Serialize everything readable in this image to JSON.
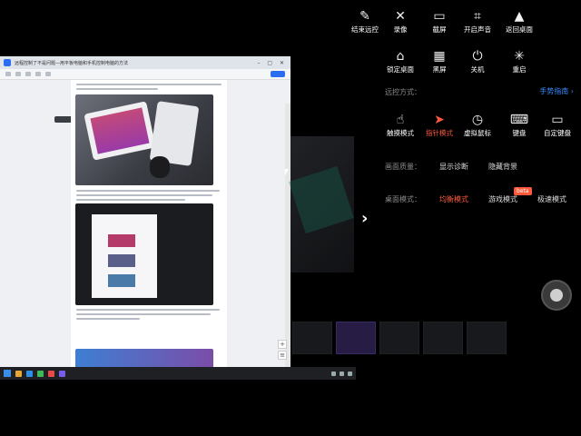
{
  "remote": {
    "doc_title": "远程控制了不是问题—用平板电脑和手机控制电脑的方法",
    "bookmark": "目录目录"
  },
  "toolbar": {
    "row1": [
      {
        "id": "end",
        "icon": "✎",
        "label": "结束远控"
      },
      {
        "id": "close",
        "icon": "✕",
        "label": "录像"
      },
      {
        "id": "record",
        "icon": "▭",
        "label": "截屏"
      },
      {
        "id": "crop",
        "icon": "⌗",
        "label": "开启声音"
      },
      {
        "id": "desktop",
        "icon": "▲",
        "label": "返回桌面"
      }
    ],
    "row2": [
      {
        "id": "lock",
        "icon": "⌂",
        "label": "锁定桌面"
      },
      {
        "id": "blackscreen",
        "icon": "▦",
        "label": "黑屏"
      },
      {
        "id": "power",
        "icon": "⏻",
        "label": "关机"
      },
      {
        "id": "restart",
        "icon": "✳",
        "label": "重启"
      }
    ]
  },
  "control_mode": {
    "label": "远控方式：",
    "guide": "手势指南 ›",
    "options": [
      {
        "icon": "☝",
        "label": "触摸模式",
        "active": false
      },
      {
        "icon": "➤",
        "label": "指针模式",
        "active": true
      },
      {
        "icon": "◷",
        "label": "虚拟鼠标",
        "active": false
      },
      {
        "icon": "⌨",
        "label": "键盘",
        "active": false
      },
      {
        "icon": "▭",
        "label": "自定键盘",
        "active": false
      }
    ]
  },
  "quality": {
    "label": "画面质量：",
    "options": [
      "显示诊断",
      "隐藏背景"
    ]
  },
  "desktop_mode": {
    "label": "桌面模式：",
    "options": [
      {
        "label": "均衡模式",
        "active": true
      },
      {
        "label": "游戏模式",
        "active": false
      },
      {
        "label": "极速模式",
        "active": false
      }
    ],
    "beta": "beta"
  },
  "accent": "#ff5a3c",
  "link": "#3a8bff"
}
